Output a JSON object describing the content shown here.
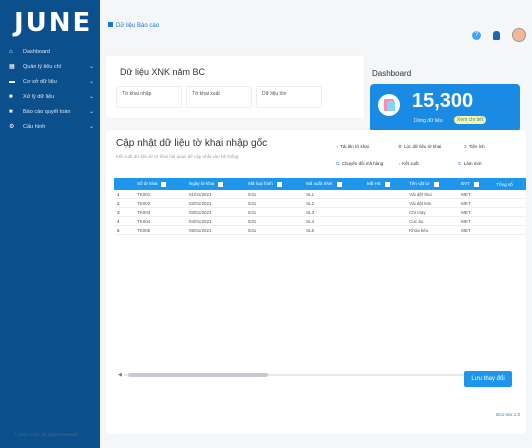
{
  "app": {
    "logo": "JUNE"
  },
  "sidebar": {
    "items": [
      {
        "label": "Dashboard",
        "icon": "home-icon",
        "expandable": false
      },
      {
        "label": "Quản lý tiêu chí",
        "icon": "grid-icon",
        "expandable": true
      },
      {
        "label": "Cơ sở dữ liệu",
        "icon": "database-icon",
        "expandable": true
      },
      {
        "label": "Xử lý dữ liệu",
        "icon": "document-icon",
        "expandable": true
      },
      {
        "label": "Báo cáo quyết toán",
        "icon": "report-icon",
        "expandable": true
      },
      {
        "label": "Cấu hình",
        "icon": "gear-icon",
        "expandable": true
      }
    ]
  },
  "breadcrumb": {
    "text": "Dữ liệu Báo cáo"
  },
  "stats": {
    "title": "Dữ liệu XNK năm BC",
    "tiles": [
      {
        "label": "Tờ khai nhập"
      },
      {
        "label": "Tờ khai xuất"
      },
      {
        "label": "Dữ liệu tồn"
      }
    ]
  },
  "dashboard": {
    "title": "Dashboard",
    "value": "15,300",
    "label": "Dòng dữ liệu",
    "badge": "Xem chi tiết"
  },
  "table": {
    "title": "Cập nhật dữ liệu tờ khai nhập gốc",
    "subtitle": "Kết xuất dữ liệu từ tờ khai hải quan để cập nhật vào hệ thống",
    "actions": [
      "Tải lên tờ khai",
      "Lọc dữ liệu tờ khai",
      "Tiện ích",
      "Chuyển đổi mã hàng",
      "Kết xuất",
      "Làm mới"
    ],
    "columns": [
      "Số tờ khai",
      "Ngày tờ khai",
      "Mã loại hình",
      "Mã xuất XNK",
      "Mã HS",
      "Tên vật tư",
      "ĐVT",
      "Tổng số"
    ],
    "rows": [
      [
        "1",
        "TK001",
        "01/01/2021",
        "E31",
        "SL1",
        "",
        "Vải dệt thoi",
        "MET",
        ""
      ],
      [
        "2",
        "TK002",
        "02/01/2021",
        "E31",
        "SL2",
        "",
        "Vải dệt kim",
        "MET",
        ""
      ],
      [
        "3",
        "TK003",
        "03/01/2021",
        "E31",
        "SL3",
        "",
        "Chỉ may",
        "MET",
        ""
      ],
      [
        "4",
        "TK004",
        "04/01/2021",
        "E31",
        "SL4",
        "",
        "Cúc áo",
        "MET",
        ""
      ],
      [
        "5",
        "TK005",
        "05/01/2021",
        "E31",
        "SL5",
        "",
        "Khóa kéo",
        "MET",
        ""
      ]
    ]
  },
  "save_button": {
    "label": "Lưu thay đổi"
  },
  "version": "Eco-mix 1.0",
  "footer": {
    "text": "© 2021 Coin. All rights reserved."
  },
  "colors": {
    "sidebar": "#0b4f8c",
    "accent": "#1e96ec"
  }
}
